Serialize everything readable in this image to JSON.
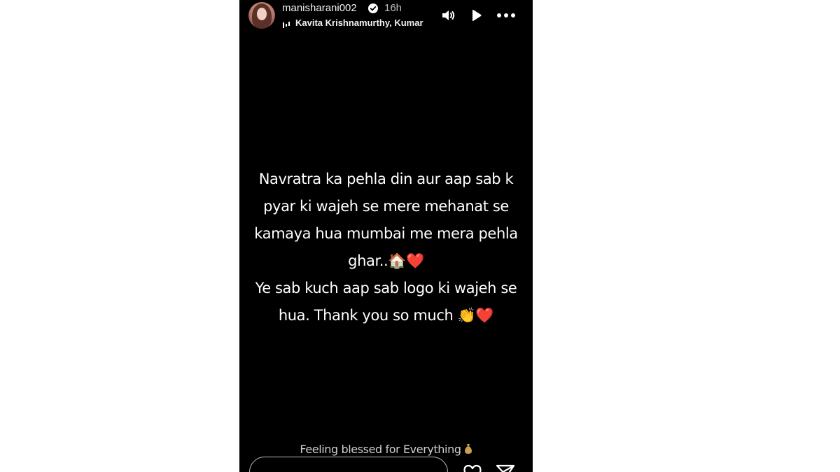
{
  "story": {
    "author": {
      "username": "manisharani002",
      "verified": true,
      "posted_ago": "16h"
    },
    "music": {
      "icon": "music-bars-icon",
      "label": "Kavita Krishnamurthy, Kumar"
    },
    "controls": {
      "sound_icon": "speaker-icon",
      "play_icon": "play-icon",
      "more_icon": "more-dots-icon"
    },
    "text_lines": [
      "Navratra ka pehla din aur aap sab k",
      "pyar ki wajeh se mere mehanat se",
      "kamaya hua mumbai me mera pehla",
      "ghar..🏠❤️",
      "Ye sab kuch aap sab logo ki wajeh se",
      "hua. Thank you so much 👏❤️"
    ],
    "caption": "Feeling blessed for Everything",
    "caption_icon": "money-bag-icon",
    "reply": {
      "placeholder": "",
      "value": ""
    },
    "actions": {
      "like_icon": "heart-icon",
      "share_icon": "send-icon"
    }
  },
  "colors": {
    "story_background": "#000000",
    "page_background": "#ffffff",
    "text_primary": "#ffffff",
    "text_secondary": "#bdbdbd"
  }
}
